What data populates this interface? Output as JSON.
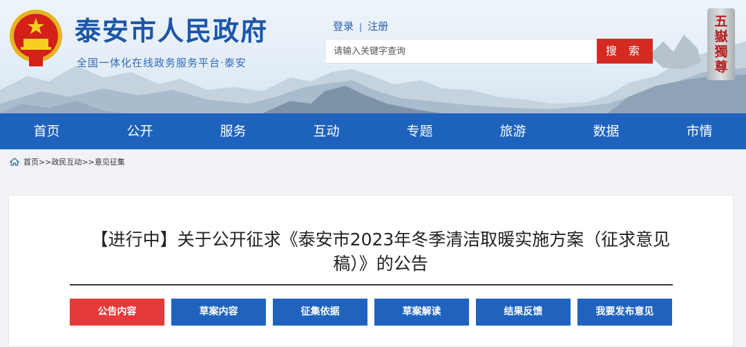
{
  "header": {
    "site_title": "泰安市人民政府",
    "site_subtitle": "全国一体化在线政务服务平台·泰安",
    "login_label": "登录",
    "register_label": "注册",
    "separator": "|",
    "search_placeholder": "请输入关键字查询",
    "search_button": "搜 索",
    "stele_text": "五嶽獨尊"
  },
  "nav": {
    "items": [
      "首页",
      "公开",
      "服务",
      "互动",
      "专题",
      "旅游",
      "数据",
      "市情"
    ]
  },
  "breadcrumb": {
    "home": "首页",
    "sep1": ">>",
    "section": "政民互动",
    "sep2": ">>",
    "current": "意见征集"
  },
  "article": {
    "title": "【进行中】关于公开征求《泰安市2023年冬季清洁取暖实施方案（征求意见稿）》的公告",
    "tabs": [
      "公告内容",
      "草案内容",
      "征集依据",
      "草案解读",
      "结果反馈",
      "我要发布意见"
    ],
    "active_tab": 0
  },
  "colors": {
    "nav_bg": "#1d62bd",
    "active_tab": "#e5393a",
    "tab": "#1f63be",
    "search_button": "#d42a21",
    "title_blue": "#1c56a8"
  }
}
